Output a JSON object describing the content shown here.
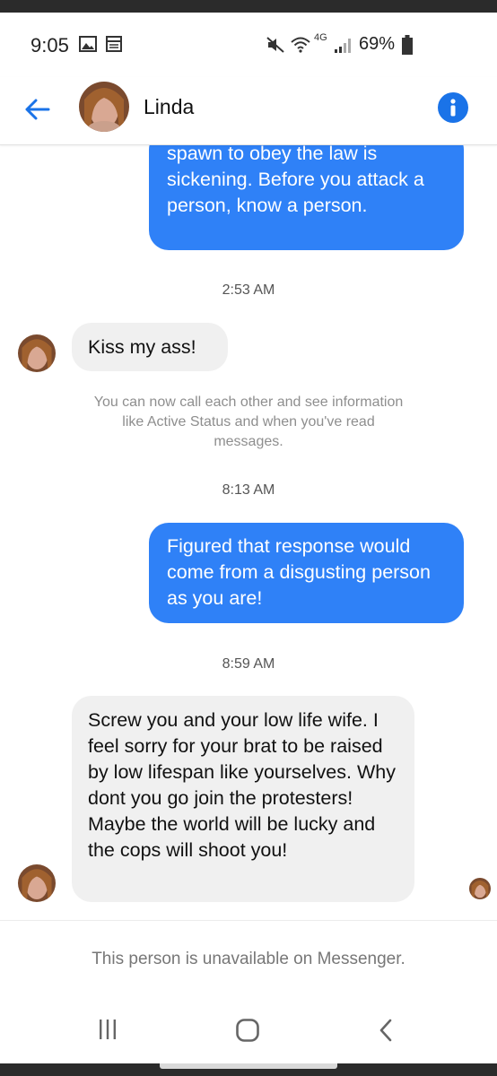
{
  "status_bar": {
    "time": "9:05",
    "network": "4G",
    "battery": "69%"
  },
  "header": {
    "contact_name": "Linda"
  },
  "messages": [
    {
      "from": "me",
      "text": "spawn to obey the law is sickening.  Before you attack a person, know a person."
    },
    {
      "type": "timestamp",
      "text": "2:53 AM"
    },
    {
      "from": "contact",
      "text": "Kiss my ass!"
    },
    {
      "type": "system",
      "text": "You can now call each other and see information like Active Status and when you've read messages."
    },
    {
      "type": "timestamp",
      "text": "8:13 AM"
    },
    {
      "from": "me",
      "text": "Figured that response would come from a disgusting person as you are!"
    },
    {
      "type": "timestamp",
      "text": "8:59 AM"
    },
    {
      "from": "contact",
      "text": "Screw you and your low life wife. I feel sorry for your brat to be raised by low lifespan like yourselves. Why dont you go join the protesters! Maybe the world will be lucky and the cops will shoot you!"
    }
  ],
  "footer": {
    "unavailable_notice": "This person is unavailable on Messenger."
  },
  "colors": {
    "accent": "#1a73e8",
    "outgoing_bubble": "#2f81f7",
    "incoming_bubble": "#f0f0f0"
  }
}
